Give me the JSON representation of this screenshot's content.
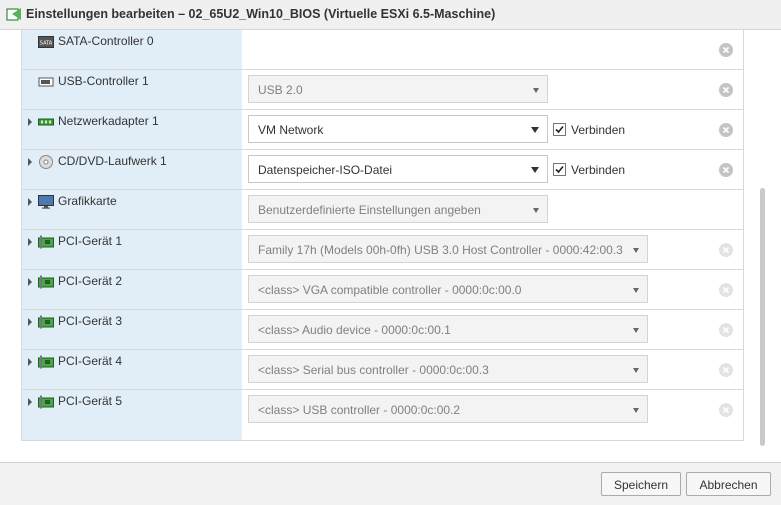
{
  "window": {
    "title": "Einstellungen bearbeiten – 02_65U2_Win10_BIOS (Virtuelle ESXi 6.5-Maschine)"
  },
  "devices": [
    {
      "label": "SATA-Controller 0",
      "icon": "sata-controller-icon",
      "expandable": false,
      "select": null,
      "connect": null,
      "remove_enabled": true
    },
    {
      "label": "USB-Controller 1",
      "icon": "usb-icon",
      "expandable": false,
      "select": {
        "value": "USB 2.0",
        "enabled": false
      },
      "connect": null,
      "remove_enabled": true
    },
    {
      "label": "Netzwerkadapter 1",
      "icon": "network-adapter-icon",
      "expandable": true,
      "select": {
        "value": "VM Network",
        "enabled": true
      },
      "connect": {
        "label": "Verbinden",
        "checked": true
      },
      "remove_enabled": true
    },
    {
      "label": "CD/DVD-Laufwerk 1",
      "icon": "cd-dvd-icon",
      "expandable": true,
      "select": {
        "value": "Datenspeicher-ISO-Datei",
        "enabled": true
      },
      "connect": {
        "label": "Verbinden",
        "checked": true
      },
      "remove_enabled": true
    },
    {
      "label": "Grafikkarte",
      "icon": "monitor-icon",
      "expandable": true,
      "select": {
        "value": "Benutzerdefinierte Einstellungen angeben",
        "enabled": false
      },
      "connect": null,
      "remove_enabled": null
    },
    {
      "label": "PCI-Gerät 1",
      "icon": "pci-device-icon",
      "expandable": true,
      "select": {
        "value": "Family 17h (Models 00h-0fh) USB 3.0 Host Controller - 0000:42:00.3",
        "enabled": false
      },
      "connect": null,
      "remove_enabled": false
    },
    {
      "label": "PCI-Gerät 2",
      "icon": "pci-device-icon",
      "expandable": true,
      "select": {
        "value": "<class> VGA compatible controller - 0000:0c:00.0",
        "enabled": false
      },
      "connect": null,
      "remove_enabled": false
    },
    {
      "label": "PCI-Gerät 3",
      "icon": "pci-device-icon",
      "expandable": true,
      "select": {
        "value": "<class> Audio device - 0000:0c:00.1",
        "enabled": false
      },
      "connect": null,
      "remove_enabled": false
    },
    {
      "label": "PCI-Gerät 4",
      "icon": "pci-device-icon",
      "expandable": true,
      "select": {
        "value": "<class> Serial bus controller - 0000:0c:00.3",
        "enabled": false
      },
      "connect": null,
      "remove_enabled": false
    },
    {
      "label": "PCI-Gerät 5",
      "icon": "pci-device-icon",
      "expandable": true,
      "select": {
        "value": "<class> USB controller - 0000:0c:00.2",
        "enabled": false
      },
      "connect": null,
      "remove_enabled": false
    }
  ],
  "footer": {
    "save_label": "Speichern",
    "cancel_label": "Abbrechen"
  }
}
